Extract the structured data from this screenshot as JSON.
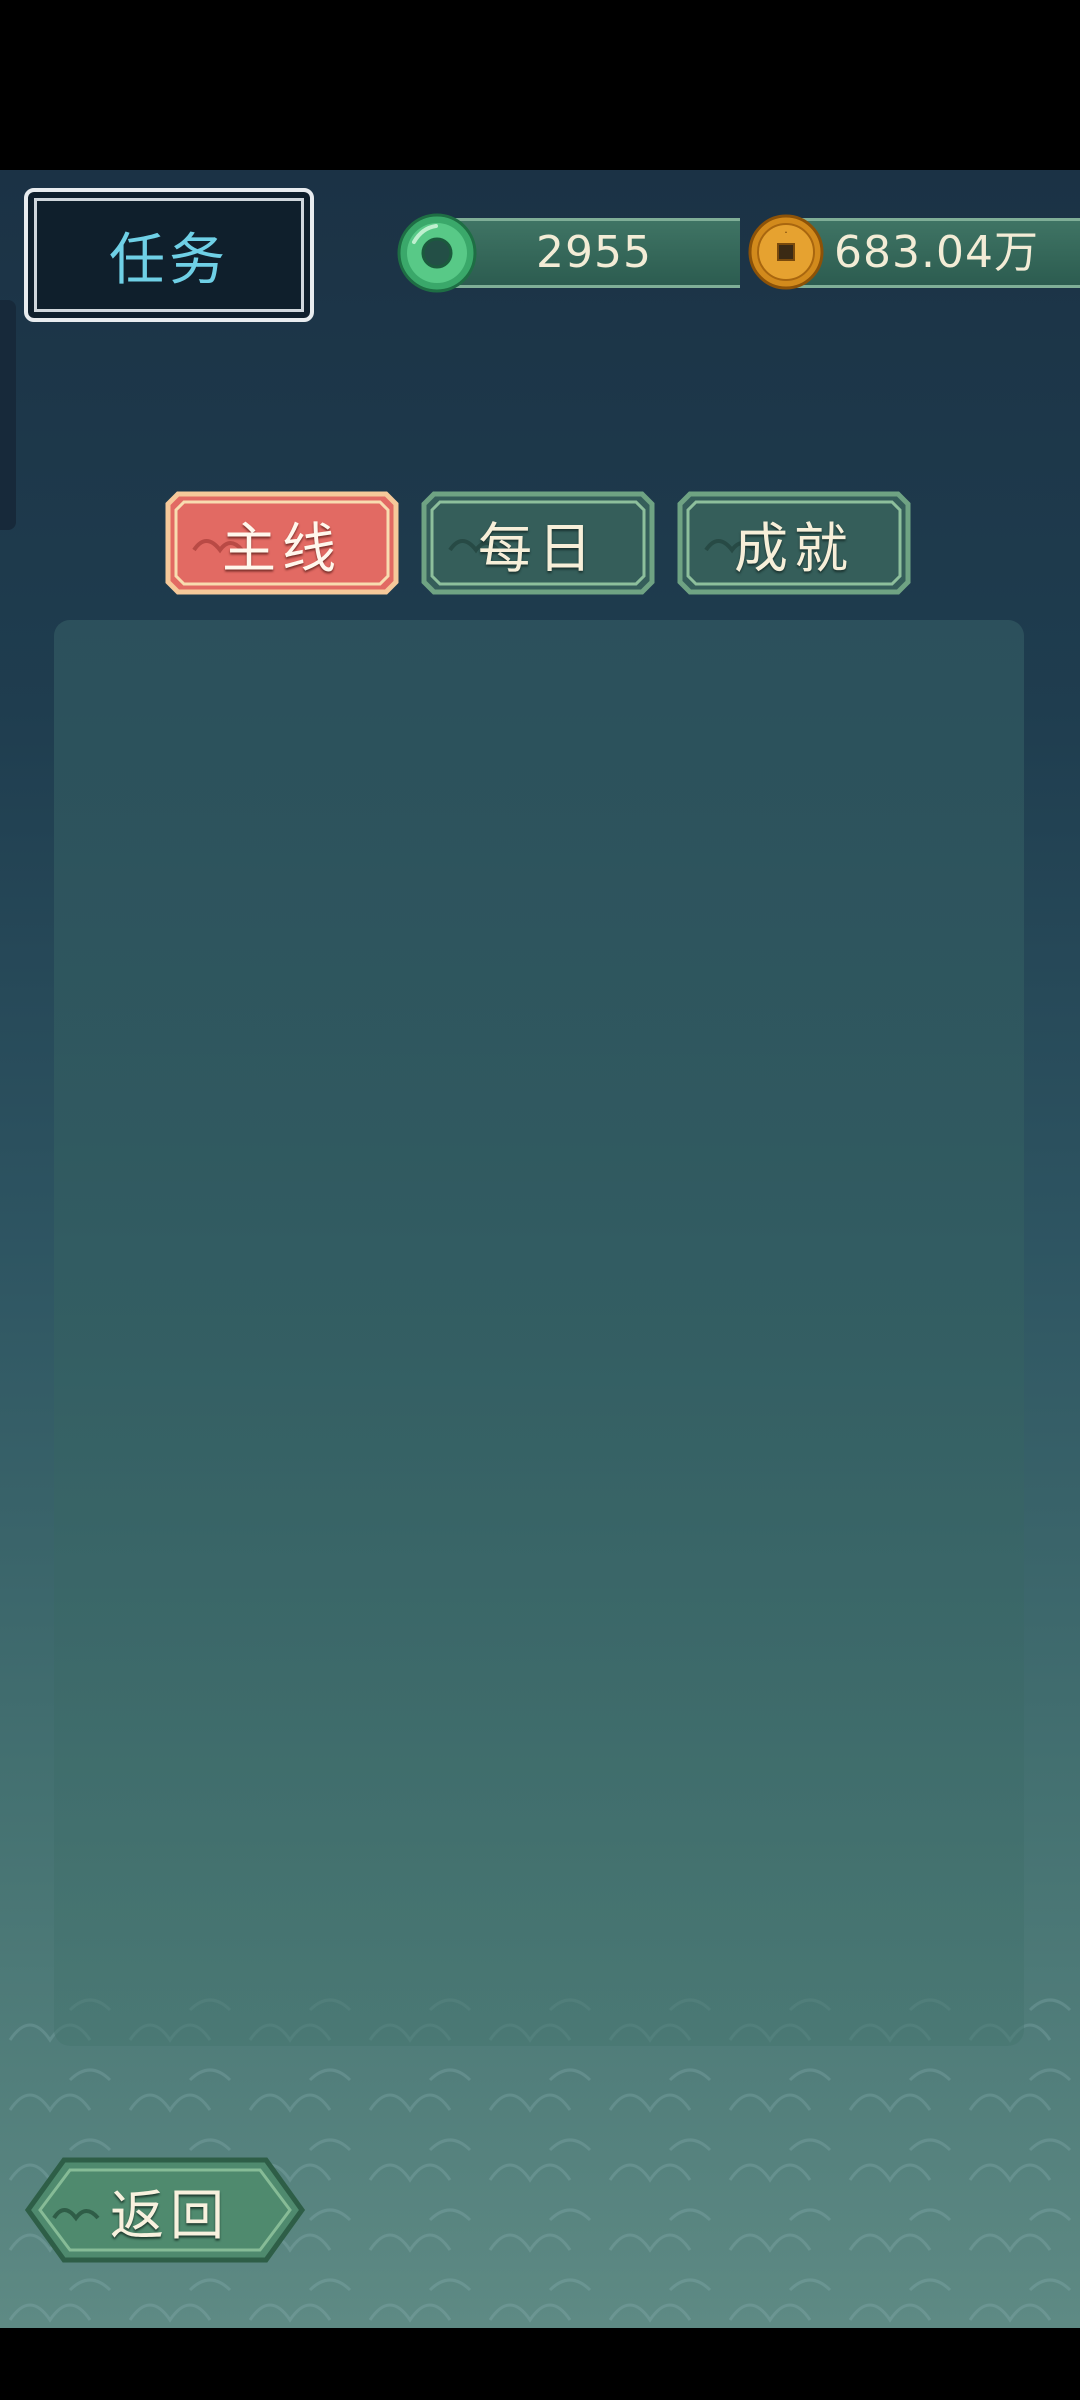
{
  "header": {
    "title": "任务"
  },
  "currencies": {
    "jade": {
      "icon": "jade-ring-icon",
      "value": "2955"
    },
    "coins": {
      "icon": "copper-coin-icon",
      "value": "683.04万"
    }
  },
  "tabs": [
    {
      "label": "主线",
      "active": true
    },
    {
      "label": "每日",
      "active": false
    },
    {
      "label": "成就",
      "active": false
    }
  ],
  "footer": {
    "back_label": "返回"
  },
  "colors": {
    "active_tab": "#e26a63",
    "inactive_tab": "#3f6f66",
    "title_text": "#6fd0e6"
  }
}
